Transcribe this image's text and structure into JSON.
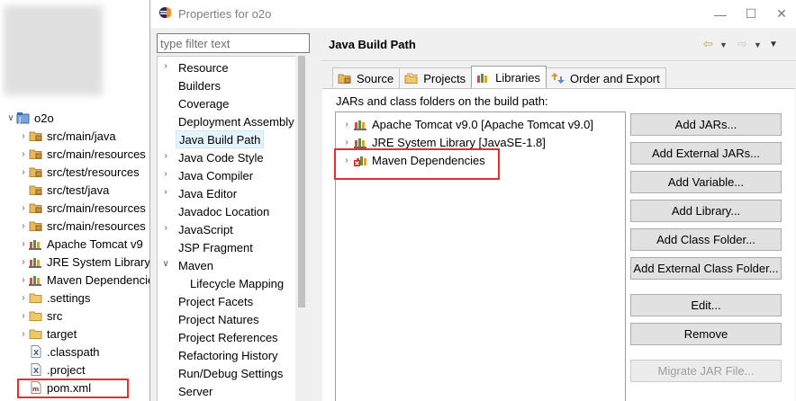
{
  "explorer": {
    "items": [
      {
        "label": "o2o",
        "icon": "project-icon",
        "twisty": "expanded"
      },
      {
        "label": "src/main/java",
        "icon": "package-folder-icon",
        "twisty": "collapsed"
      },
      {
        "label": "src/main/resources",
        "icon": "package-folder-icon",
        "twisty": "collapsed"
      },
      {
        "label": "src/test/resources",
        "icon": "package-folder-icon",
        "twisty": "collapsed"
      },
      {
        "label": "src/test/java",
        "icon": "package-folder-icon",
        "twisty": "none"
      },
      {
        "label": "src/main/resources",
        "icon": "package-folder-icon",
        "twisty": "collapsed"
      },
      {
        "label": "src/main/resources",
        "icon": "package-folder-icon",
        "twisty": "collapsed"
      },
      {
        "label": "Apache Tomcat v9",
        "icon": "library-icon",
        "twisty": "collapsed"
      },
      {
        "label": "JRE System Library",
        "icon": "library-icon",
        "twisty": "collapsed"
      },
      {
        "label": "Maven Dependencies",
        "icon": "library-icon",
        "twisty": "collapsed"
      },
      {
        "label": ".settings",
        "icon": "folder-icon",
        "twisty": "collapsed"
      },
      {
        "label": "src",
        "icon": "folder-icon",
        "twisty": "collapsed"
      },
      {
        "label": "target",
        "icon": "folder-icon",
        "twisty": "collapsed"
      },
      {
        "label": ".classpath",
        "icon": "xml-file-icon",
        "twisty": "none"
      },
      {
        "label": ".project",
        "icon": "xml-file-icon",
        "twisty": "none"
      },
      {
        "label": "pom.xml",
        "icon": "pom-file-icon",
        "twisty": "none"
      }
    ]
  },
  "dialog": {
    "title": "Properties for o2o",
    "filter_placeholder": "type filter text",
    "categories": [
      {
        "label": "Resource",
        "arrow": "collapsed"
      },
      {
        "label": "Builders",
        "arrow": "none"
      },
      {
        "label": "Coverage",
        "arrow": "none"
      },
      {
        "label": "Deployment Assembly",
        "arrow": "none"
      },
      {
        "label": "Java Build Path",
        "arrow": "none",
        "selected": true
      },
      {
        "label": "Java Code Style",
        "arrow": "collapsed"
      },
      {
        "label": "Java Compiler",
        "arrow": "collapsed"
      },
      {
        "label": "Java Editor",
        "arrow": "collapsed"
      },
      {
        "label": "Javadoc Location",
        "arrow": "none"
      },
      {
        "label": "JavaScript",
        "arrow": "collapsed"
      },
      {
        "label": "JSP Fragment",
        "arrow": "none"
      },
      {
        "label": "Maven",
        "arrow": "expanded"
      },
      {
        "label": "Lifecycle Mapping",
        "arrow": "none",
        "indent": true
      },
      {
        "label": "Project Facets",
        "arrow": "none"
      },
      {
        "label": "Project Natures",
        "arrow": "none"
      },
      {
        "label": "Project References",
        "arrow": "none"
      },
      {
        "label": "Refactoring History",
        "arrow": "none"
      },
      {
        "label": "Run/Debug Settings",
        "arrow": "none"
      },
      {
        "label": "Server",
        "arrow": "none"
      }
    ],
    "page_title": "Java Build Path",
    "tabs": [
      {
        "label": "Source",
        "icon": "source-folder-icon"
      },
      {
        "label": "Projects",
        "icon": "projects-icon"
      },
      {
        "label": "Libraries",
        "icon": "libraries-icon",
        "active": true
      },
      {
        "label": "Order and Export",
        "icon": "order-export-icon"
      }
    ],
    "jars_label": "JARs and class folders on the build path:",
    "libraries": [
      {
        "label": "Apache Tomcat v9.0 [Apache Tomcat v9.0]",
        "icon": "library-icon"
      },
      {
        "label": "JRE System Library [JavaSE-1.8]",
        "icon": "library-icon"
      },
      {
        "label": "Maven Dependencies",
        "icon": "library-error-icon"
      }
    ],
    "buttons": {
      "add_jars": "Add JARs...",
      "add_external_jars": "Add External JARs...",
      "add_variable": "Add Variable...",
      "add_library": "Add Library...",
      "add_class_folder": "Add Class Folder...",
      "add_external_class_folder": "Add External Class Folder...",
      "edit": "Edit...",
      "remove": "Remove",
      "migrate_jar": "Migrate JAR File..."
    }
  },
  "colors": {
    "highlight": "#e03030",
    "selection": "#e5f3ff",
    "button_face": "#e1e1e1"
  }
}
